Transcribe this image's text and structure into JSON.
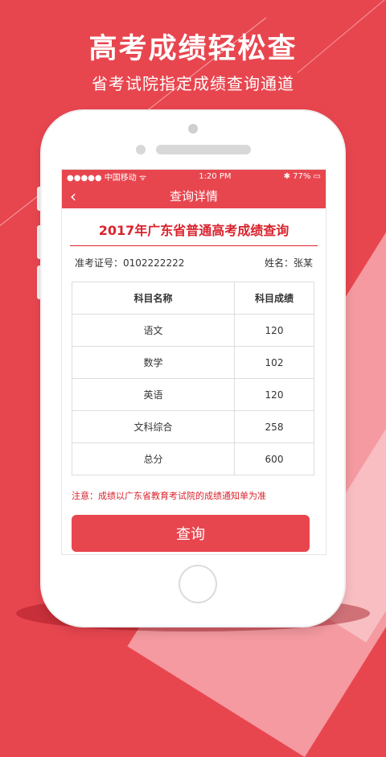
{
  "header": {
    "headline": "高考成绩轻松查",
    "subline": "省考试院指定成绩查询通道"
  },
  "status_bar": {
    "carrier": "●●●●● 中国移动 ᯤ",
    "time": "1:20 PM",
    "battery": "✱ 77% ▭"
  },
  "nav": {
    "title": "查询详情"
  },
  "main": {
    "title": "2017年广东省普通高考成绩查询",
    "exam_id_label": "准考证号：0102222222",
    "name_label": "姓名：张某",
    "table": {
      "headers": [
        "科目名称",
        "科目成绩"
      ],
      "rows": [
        [
          "语文",
          "120"
        ],
        [
          "数学",
          "102"
        ],
        [
          "英语",
          "120"
        ],
        [
          "文科综合",
          "258"
        ],
        [
          "总分",
          "600"
        ]
      ]
    },
    "note": "注意：成绩以广东省教育考试院的成绩通知单为准",
    "query_button": "查询"
  },
  "icons": {
    "back": "chevron-left-icon"
  },
  "colors": {
    "brand_red": "#e8464f",
    "text_red": "#d9232d"
  }
}
